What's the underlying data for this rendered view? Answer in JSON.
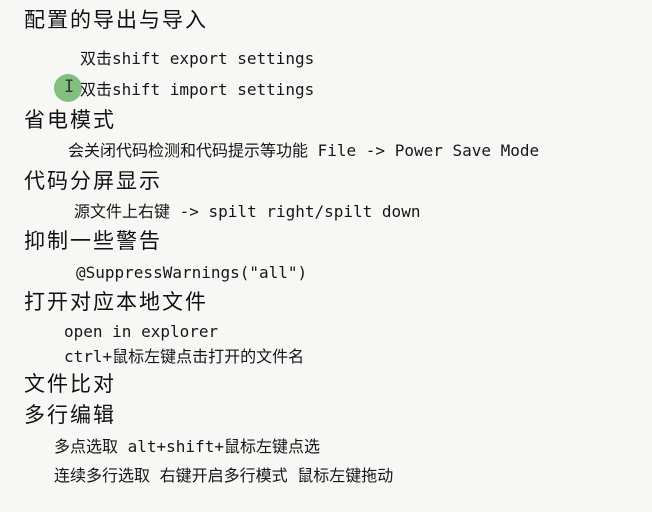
{
  "sections": [
    {
      "heading": "配置的导出与导入",
      "items": [
        "双击shift export settings",
        "双击shift import settings"
      ]
    },
    {
      "heading": "省电模式",
      "items": [
        "会关闭代码检测和代码提示等功能 File -> Power Save Mode"
      ]
    },
    {
      "heading": "代码分屏显示",
      "items": [
        "源文件上右键 -> spilt right/spilt down"
      ]
    },
    {
      "heading": "抑制一些警告",
      "items": [
        "@SuppressWarnings(\"all\")"
      ]
    },
    {
      "heading": "打开对应本地文件",
      "items": [
        "open in explorer",
        "ctrl+鼠标左键点击打开的文件名"
      ]
    },
    {
      "heading": "文件比对",
      "items": []
    },
    {
      "heading": "多行编辑",
      "items": [
        "多点选取 alt+shift+鼠标左键点选",
        "连续多行选取 右键开启多行模式 鼠标左键拖动"
      ]
    }
  ],
  "cursor": {
    "text_cursor_glyph": "I",
    "highlight_color": "#56aa52"
  }
}
